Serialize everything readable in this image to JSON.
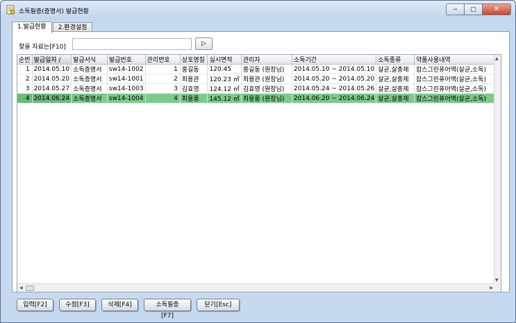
{
  "window": {
    "title": "소독필증(증명서) 발급현황",
    "min_symbol": "−",
    "max_symbol": "□",
    "close_symbol": "✕"
  },
  "tabs": [
    {
      "label": "1.발급현황",
      "active": true
    },
    {
      "label": "2.환경설정",
      "active": false
    }
  ],
  "search": {
    "label": "찾을 자료는[F10]",
    "value": "",
    "button_symbol": "▷"
  },
  "grid": {
    "columns": [
      "순번",
      "발급일자 /",
      "발급서식",
      "발급번호",
      "관리번호",
      "상호명칭",
      "실시면적",
      "관리자",
      "소독기간",
      "소독종류",
      "약품사용내역"
    ],
    "rows": [
      [
        "1",
        "2014.05.10",
        "소독증명서",
        "sw14-1002",
        "1",
        "홍길동",
        "120.45",
        "홍길동 (원장님)",
        "2014.05.10 ~ 2014.05.10",
        "살균,살충제",
        "잡스그린퓨어액(살균,소독)"
      ],
      [
        "2",
        "2014.05.20",
        "소독증명서",
        "sw14-1001",
        "2",
        "최용관",
        "120.23 ㎡",
        "최용관 (원장님)",
        "2014.05.20 ~ 2014.05.20",
        "살균,살충제",
        "잡스그린퓨어액(살균,소독)"
      ],
      [
        "3",
        "2014.05.27",
        "소독증명서",
        "sw14-1003",
        "3",
        "김효영",
        "124.12 ㎡",
        "김효영 (원장님)",
        "2014.05.24 ~ 2014.05.26",
        "살균,살충제",
        "잡스그린퓨어액(살균,소독)"
      ],
      [
        "4",
        "2014.06.24",
        "소독증명서",
        "sw14-1004",
        "4",
        "최용롱",
        "145.12 ㎡",
        "최용롱 (원장님)",
        "2014.06.20 ~ 2014.06.24",
        "살균,살충제",
        "잡스그린퓨어액(살균,소독)"
      ]
    ],
    "selected_row": 3,
    "selection_color": "#7dc98a"
  },
  "buttons": {
    "input": "입력[F2]",
    "edit": "수정[F3]",
    "delete": "삭제[F4]",
    "certificate": "소독필증[F7]",
    "close": "닫기[Esc]"
  }
}
